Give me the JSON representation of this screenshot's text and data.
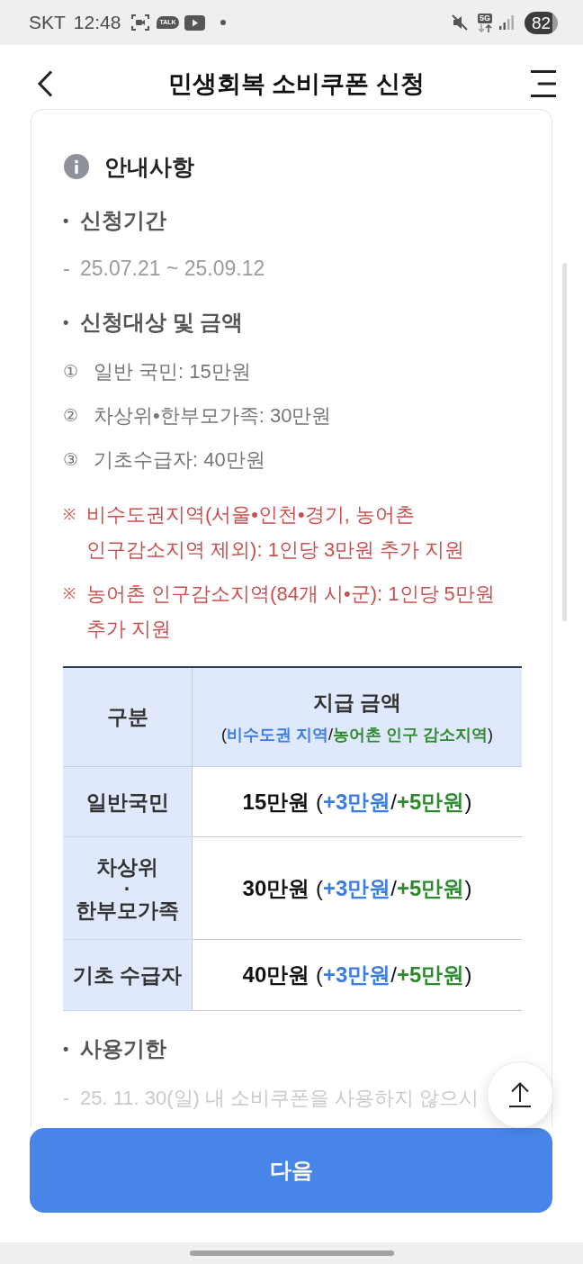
{
  "status_bar": {
    "carrier": "SKT",
    "time": "12:48",
    "chat_badge": "TALK",
    "network_type": "5G",
    "battery": "82"
  },
  "header": {
    "title": "민생회복 소비쿠폰 신청"
  },
  "notice": {
    "title": "안내사항",
    "sections": [
      {
        "bullet": "•",
        "heading": "신청기간",
        "items": [
          {
            "kind": "dash",
            "marker": "-",
            "text": "25.07.21 ~ 25.09.12"
          }
        ]
      },
      {
        "bullet": "•",
        "heading": "신청대상 및 금액",
        "items": [
          {
            "kind": "numbered",
            "marker": "①",
            "text": "일반 국민: 15만원"
          },
          {
            "kind": "numbered",
            "marker": "②",
            "text": "차상위•한부모가족: 30만원"
          },
          {
            "kind": "numbered",
            "marker": "③",
            "text": "기초수급자: 40만원"
          },
          {
            "kind": "note",
            "marker": "※",
            "text": "비수도권지역(서울•인천•경기, 농어촌 인구감소지역 제외): 1인당 3만원 추가 지원"
          },
          {
            "kind": "note",
            "marker": "※",
            "text": "농어촌 인구감소지역(84개 시•군): 1인당 5만원 추가 지원"
          }
        ],
        "table": {
          "header": {
            "category": "구분",
            "amount": "지급 금액",
            "amount_note": [
              {
                "kind": "plain",
                "text": "("
              },
              {
                "kind": "nonmetro",
                "text": "비수도권 지역"
              },
              {
                "kind": "plain",
                "text": "/"
              },
              {
                "kind": "rural",
                "text": "농어촌 인구 감소지역"
              },
              {
                "kind": "plain",
                "text": ")"
              }
            ]
          },
          "rows": [
            {
              "category": "일반국민",
              "amount": [
                {
                  "kind": "base",
                  "text": "15만원"
                },
                {
                  "kind": "plain",
                  "text": " ("
                },
                {
                  "kind": "nonmetro",
                  "text": "+3만원"
                },
                {
                  "kind": "plain",
                  "text": "/"
                },
                {
                  "kind": "rural",
                  "text": "+5만원"
                },
                {
                  "kind": "plain",
                  "text": ")"
                }
              ]
            },
            {
              "category": "차상위\n·\n한부모가족",
              "amount": [
                {
                  "kind": "base",
                  "text": "30만원"
                },
                {
                  "kind": "plain",
                  "text": " ("
                },
                {
                  "kind": "nonmetro",
                  "text": "+3만원"
                },
                {
                  "kind": "plain",
                  "text": "/"
                },
                {
                  "kind": "rural",
                  "text": "+5만원"
                },
                {
                  "kind": "plain",
                  "text": ")"
                }
              ]
            },
            {
              "category": "기초 수급자",
              "amount": [
                {
                  "kind": "base",
                  "text": "40만원"
                },
                {
                  "kind": "plain",
                  "text": " ("
                },
                {
                  "kind": "nonmetro",
                  "text": "+3만원"
                },
                {
                  "kind": "plain",
                  "text": "/"
                },
                {
                  "kind": "rural",
                  "text": "+5만원"
                },
                {
                  "kind": "plain",
                  "text": ")"
                }
              ]
            }
          ]
        }
      },
      {
        "bullet": "•",
        "heading": "사용기한",
        "items": [
          {
            "kind": "fading",
            "marker": "-",
            "text": "25. 11. 30(일) 내 소비쿠폰을 사용하지 않으시"
          }
        ]
      }
    ]
  },
  "next_button": {
    "label": "다음"
  }
}
